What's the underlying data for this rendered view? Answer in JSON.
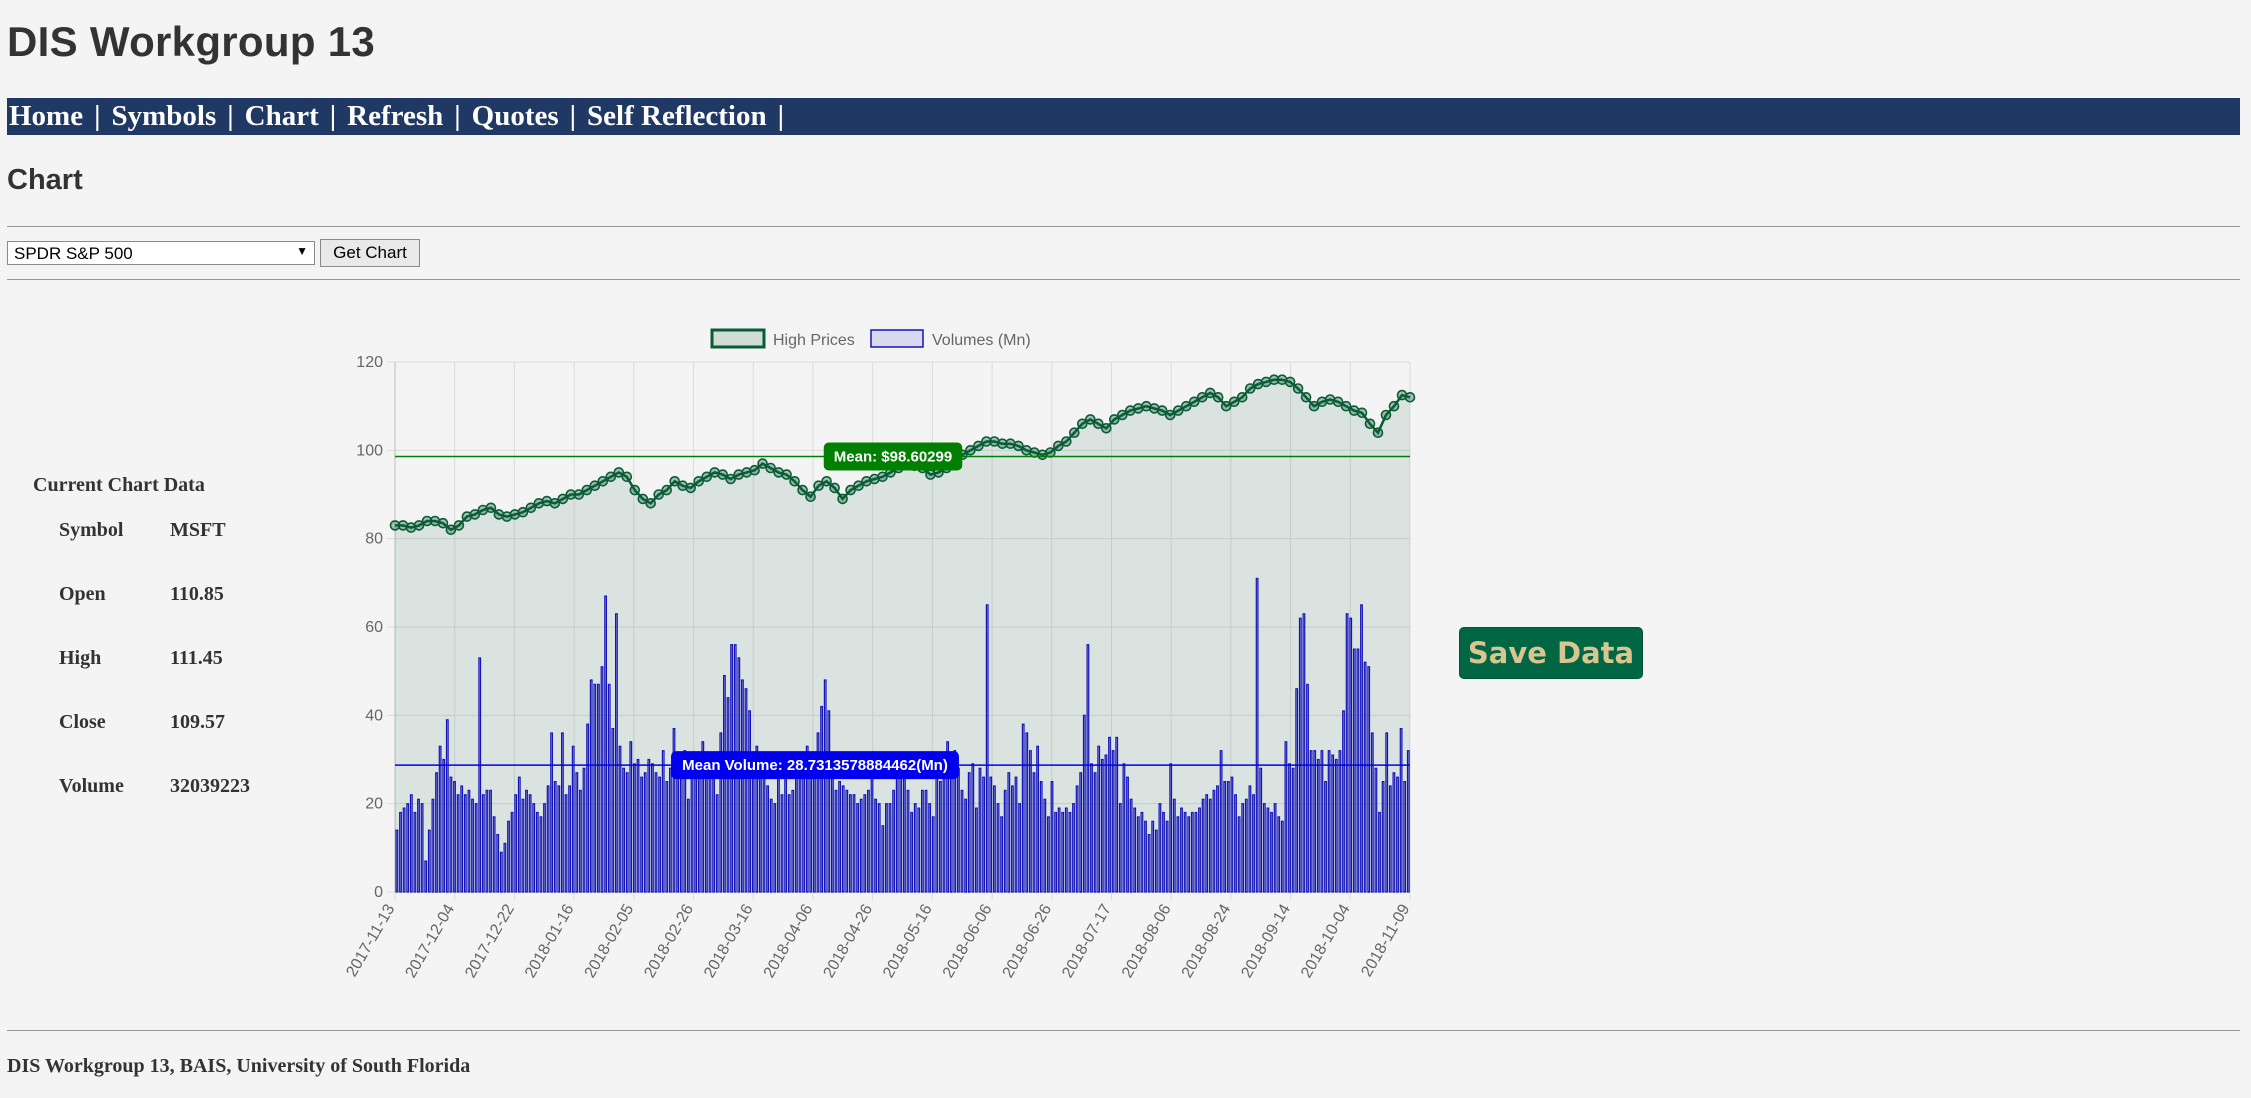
{
  "site_title": "DIS Workgroup 13",
  "nav": {
    "items": [
      "Home",
      "Symbols",
      "Chart",
      "Refresh",
      "Quotes",
      "Self Reflection"
    ],
    "separator": "|"
  },
  "page_heading": "Chart",
  "symbol_select": {
    "selected": "SPDR S&P 500"
  },
  "get_chart_label": "Get Chart",
  "current_data": {
    "title": "Current Chart Data",
    "rows": [
      {
        "label": "Symbol",
        "value": "MSFT"
      },
      {
        "label": "Open",
        "value": "110.85"
      },
      {
        "label": "High",
        "value": "111.45"
      },
      {
        "label": "Close",
        "value": "109.57"
      },
      {
        "label": "Volume",
        "value": "32039223"
      }
    ]
  },
  "save_data_label": "Save Data",
  "footer": "DIS Workgroup 13, BAIS, University of South Florida",
  "chart_data": {
    "type": "line",
    "ylim": [
      0,
      120
    ],
    "yticks": [
      0,
      20,
      40,
      60,
      80,
      100,
      120
    ],
    "grid": true,
    "legend_position": "top-center",
    "x_tick_labels": [
      "2017-11-13",
      "2017-12-04",
      "2017-12-22",
      "2018-01-16",
      "2018-02-05",
      "2018-02-26",
      "2018-03-16",
      "2018-04-06",
      "2018-04-26",
      "2018-05-16",
      "2018-06-06",
      "2018-06-26",
      "2018-07-17",
      "2018-08-06",
      "2018-08-24",
      "2018-09-14",
      "2018-10-04",
      "2018-11-09"
    ],
    "series": [
      {
        "name": "High Prices",
        "kind": "line-area",
        "color": "#0a5c36",
        "values": [
          83,
          83,
          82.5,
          83,
          84,
          84,
          83.5,
          82,
          83,
          85,
          85.5,
          86.5,
          87,
          85.5,
          85,
          85.5,
          86,
          87,
          88,
          88.5,
          88,
          89,
          90,
          90,
          91,
          92,
          93,
          94,
          95,
          94,
          91,
          89,
          88,
          90,
          91,
          93,
          92,
          91.5,
          93,
          94,
          95,
          94.5,
          93.5,
          94.5,
          95,
          95.5,
          97,
          96,
          95,
          94.5,
          93,
          91,
          89.5,
          92,
          93,
          91.5,
          89,
          91,
          92,
          93,
          93.5,
          94,
          95,
          96,
          97,
          96.5,
          96,
          94.5,
          95,
          96,
          98,
          99,
          100,
          101,
          102,
          102,
          101.5,
          101.5,
          101,
          100,
          99.5,
          99,
          99.5,
          101,
          102,
          104,
          106,
          107,
          106,
          105,
          107,
          108,
          109,
          109.5,
          110,
          109.5,
          109,
          108,
          109,
          110,
          111,
          112,
          113,
          112,
          110,
          111,
          112,
          114,
          115,
          115.5,
          116,
          116,
          115.5,
          114,
          112,
          110,
          111,
          111.5,
          111,
          110,
          109,
          108.5,
          106,
          104,
          108,
          110,
          112.5,
          112
        ]
      },
      {
        "name": "Volumes (Mn)",
        "kind": "bar",
        "color": "#1414b8",
        "values": [
          14,
          18,
          19,
          20,
          22,
          18,
          21,
          20,
          7,
          14,
          21,
          27,
          33,
          30,
          39,
          26,
          25,
          22,
          24,
          22,
          23,
          21,
          20,
          53,
          22,
          23,
          23,
          17,
          13,
          9,
          11,
          16,
          18,
          22,
          26,
          21,
          23,
          22,
          20,
          18,
          17,
          20,
          24,
          36,
          25,
          24,
          36,
          22,
          24,
          33,
          27,
          23,
          28,
          38,
          48,
          47,
          47,
          51,
          67,
          47,
          37,
          63,
          33,
          28,
          27,
          34,
          29,
          30,
          26,
          27,
          30,
          29,
          27,
          26,
          32,
          25,
          28,
          37,
          26,
          28,
          32,
          21,
          30,
          27,
          26,
          34,
          27,
          29,
          26,
          22,
          36,
          49,
          44,
          56,
          56,
          53,
          48,
          46,
          41,
          29,
          33,
          30,
          26,
          24,
          21,
          20,
          26,
          22,
          30,
          22,
          23,
          26,
          30,
          29,
          33,
          26,
          30,
          36,
          42,
          48,
          41,
          27,
          23,
          25,
          24,
          23,
          22,
          22,
          20,
          21,
          22,
          23,
          28,
          21,
          20,
          15,
          20,
          20,
          23,
          29,
          30,
          27,
          23,
          18,
          20,
          19,
          23,
          23,
          20,
          17,
          27,
          25,
          28,
          34,
          27,
          32,
          28,
          23,
          21,
          27,
          29,
          19,
          28,
          26,
          65,
          26,
          24,
          20,
          17,
          23,
          27,
          24,
          26,
          20,
          38,
          36,
          32,
          27,
          33,
          25,
          21,
          17,
          25,
          18,
          19,
          18,
          19,
          18,
          20,
          24,
          27,
          40,
          56,
          29,
          27,
          33,
          30,
          31,
          35,
          32,
          35,
          20,
          29,
          26,
          21,
          19,
          17,
          18,
          16,
          13,
          16,
          14,
          20,
          18,
          16,
          29,
          21,
          17,
          19,
          18,
          17,
          18,
          18,
          19,
          21,
          22,
          21,
          23,
          24,
          32,
          25,
          25,
          26,
          22,
          17,
          20,
          21,
          24,
          22,
          71,
          28,
          20,
          19,
          18,
          20,
          17,
          16,
          34,
          29,
          28,
          46,
          62,
          63,
          47,
          32,
          32,
          30,
          32,
          25,
          32,
          31,
          30,
          32,
          41,
          63,
          62,
          55,
          55,
          65,
          52,
          51,
          36,
          28,
          18,
          25,
          36,
          24,
          27,
          26,
          37,
          25,
          32
        ]
      }
    ],
    "mean_lines": [
      {
        "label": "Mean: $98.60299",
        "value": 98.60299,
        "color": "#008000"
      },
      {
        "label": "Mean Volume: 28.7313578884462(Mn)",
        "value": 28.7313578884462,
        "color": "#0000ee"
      }
    ]
  }
}
